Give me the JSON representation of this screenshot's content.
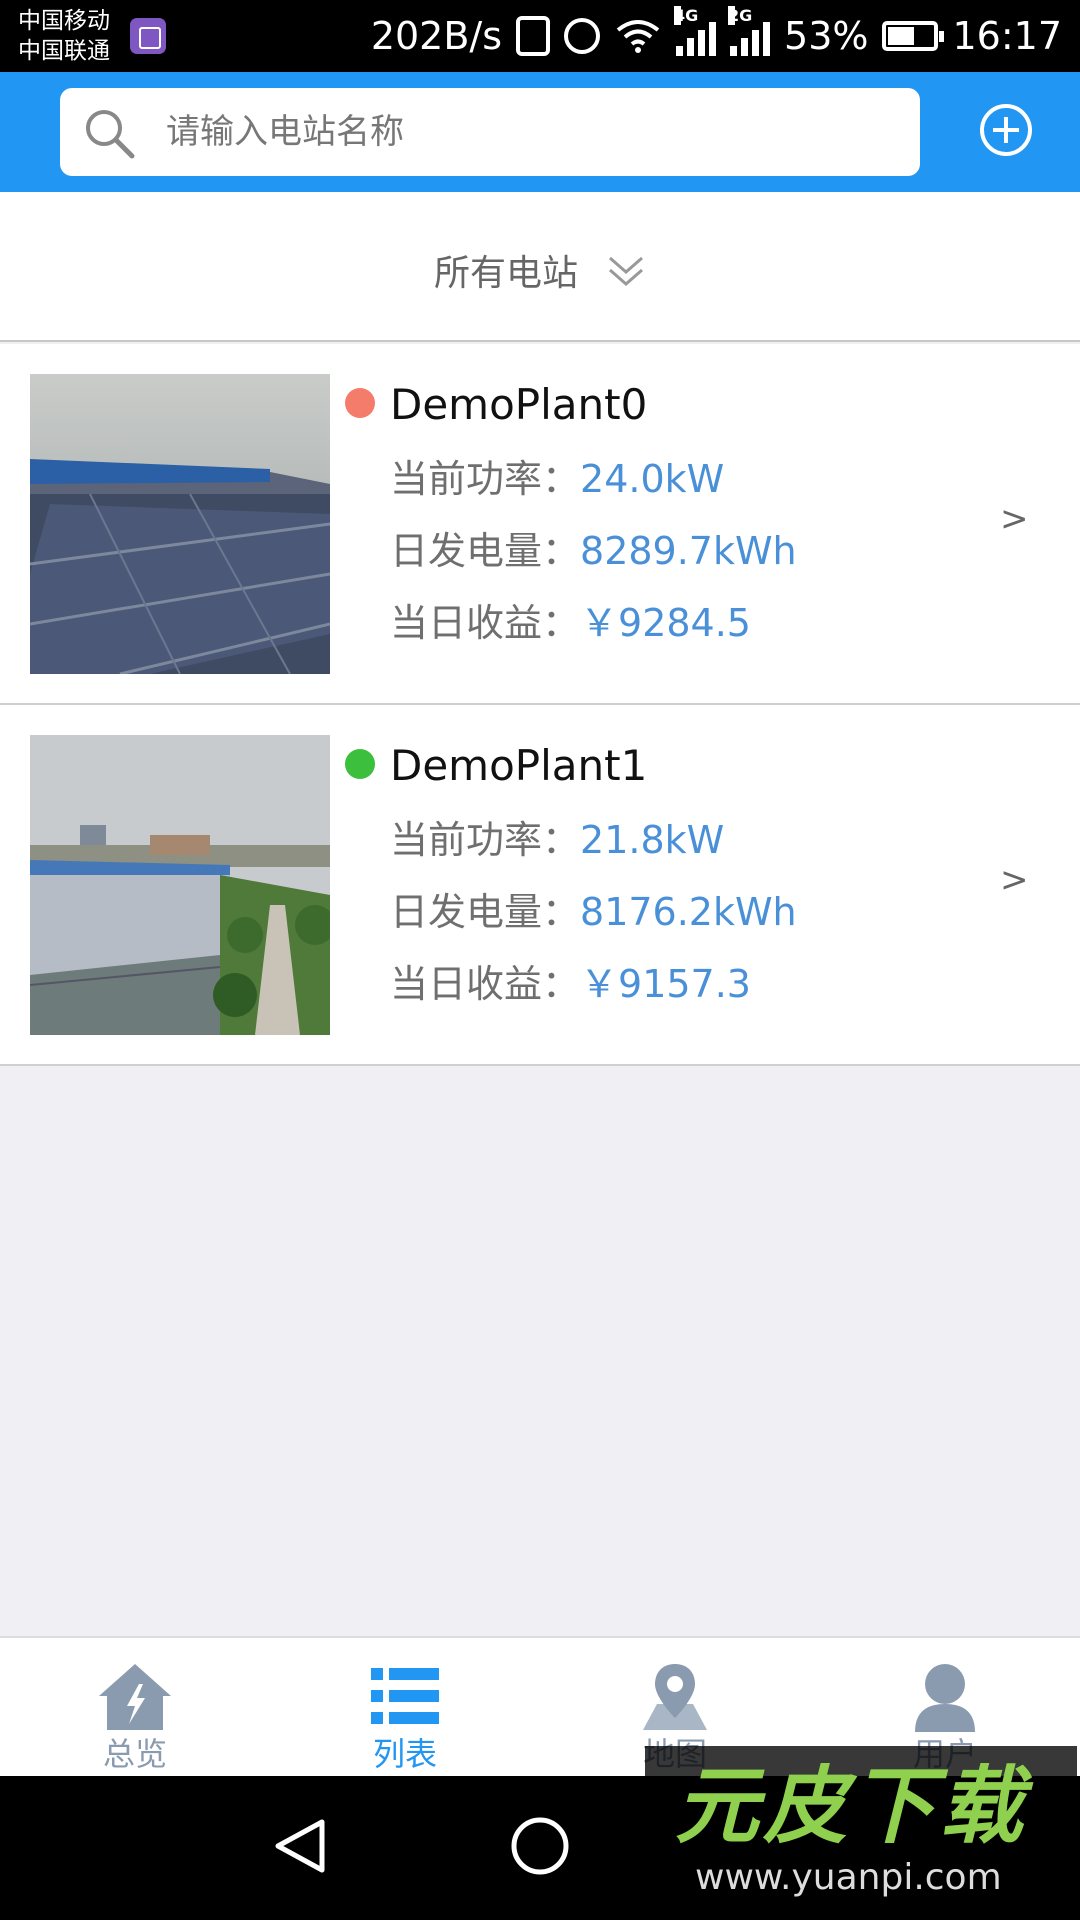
{
  "status_bar": {
    "carrier_1": "中国移动",
    "carrier_2": "中国联通",
    "net_speed": "202B/s",
    "network_type_1": "4G",
    "network_type_2": "2G",
    "battery": "53%",
    "time": "16:17"
  },
  "header": {
    "search_placeholder": "请输入电站名称"
  },
  "filter": {
    "label": "所有电站"
  },
  "plants": [
    {
      "name": "DemoPlant0",
      "status_color": "#f47c6b",
      "power_label": "当前功率：",
      "power_value": "24.0kW",
      "energy_label": "日发电量：",
      "energy_value": "8289.7kWh",
      "income_label": "当日收益：",
      "income_value": "￥9284.5",
      "chevron": ">"
    },
    {
      "name": "DemoPlant1",
      "status_color": "#3cbf3c",
      "power_label": "当前功率：",
      "power_value": "21.8kW",
      "energy_label": "日发电量：",
      "energy_value": "8176.2kWh",
      "income_label": "当日收益：",
      "income_value": "￥9157.3",
      "chevron": ">"
    }
  ],
  "bottom_nav": {
    "items": [
      {
        "label": "总览",
        "active": false
      },
      {
        "label": "列表",
        "active": true
      },
      {
        "label": "地图",
        "active": false
      },
      {
        "label": "用户",
        "active": false
      }
    ],
    "active_color": "#2196f3",
    "inactive_color": "#8a9bb0"
  },
  "watermark": {
    "title": "元皮下载",
    "url": "www.yuanpi.com"
  }
}
